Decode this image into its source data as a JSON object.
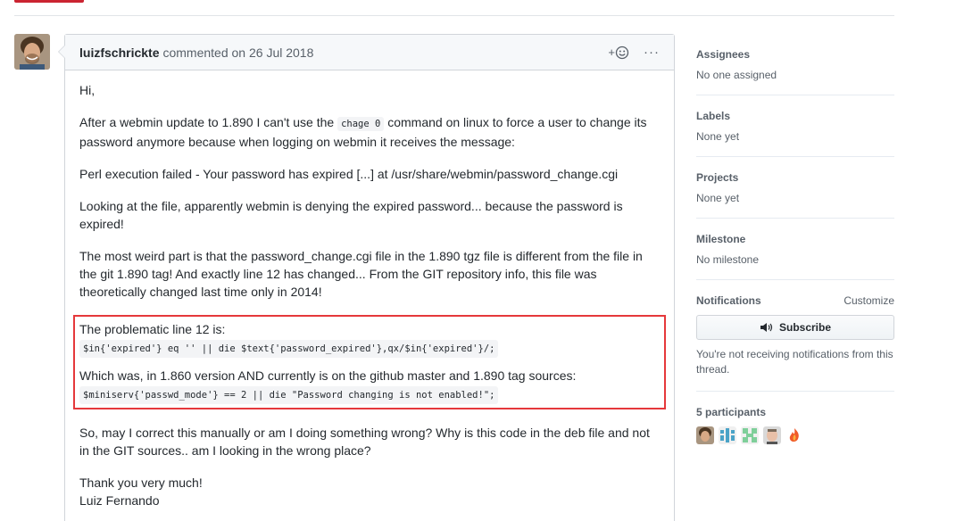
{
  "comment": {
    "author": "luizfschrickte",
    "meta": "commented on 26 Jul 2018",
    "reaction_icon": "smiley-icon",
    "more_label": "···",
    "paragraphs": {
      "greeting": "Hi,",
      "p1_before": "After a webmin update to 1.890 I can't use the ",
      "p1_code": "chage 0",
      "p1_after": " command on linux to force a user to change its password anymore because when logging on webmin it receives the message:",
      "p2": "Perl execution failed - Your password has expired [...] at /usr/share/webmin/password_change.cgi",
      "p3": "Looking at the file, apparently webmin is denying the expired password... because the password is expired!",
      "p4": "The most weird part is that the password_change.cgi file in the 1.890 tgz file is different from the file in the git 1.890 tag! And exactly line 12 has changed... From the GIT repository info, this file was theoretically changed last time only in 2014!",
      "h1": "The problematic line 12 is:",
      "code1": "$in{'expired'} eq '' || die $text{'password_expired'},qx/$in{'expired'}/;",
      "h2": "Which was, in 1.860 version AND currently is on the github master and 1.890 tag sources:",
      "code2": "$miniserv{'passwd_mode'} == 2 || die \"Password changing is not enabled!\";",
      "p5": "So, may I correct this manually or am I doing something wrong? Why is this code in the deb file and not in the GIT sources.. am I looking in the wrong place?",
      "thanks": "Thank you very much!",
      "signature": "Luiz Fernando"
    }
  },
  "sidebar": {
    "assignees": {
      "heading": "Assignees",
      "value": "No one assigned"
    },
    "labels": {
      "heading": "Labels",
      "value": "None yet"
    },
    "projects": {
      "heading": "Projects",
      "value": "None yet"
    },
    "milestone": {
      "heading": "Milestone",
      "value": "No milestone"
    },
    "notifications": {
      "heading": "Notifications",
      "customize": "Customize",
      "subscribe_label": "Subscribe",
      "subscribe_icon": "speaker-icon",
      "text": "You're not receiving notifications from this thread."
    },
    "participants": {
      "heading": "5 participants"
    }
  },
  "colors": {
    "highlight_border": "#e5383b",
    "top_strip": "#cb2431"
  }
}
